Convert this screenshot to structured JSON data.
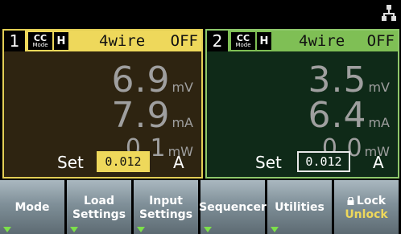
{
  "channels": [
    {
      "number": "1",
      "mode": "CC",
      "mode_label": "Mode",
      "range": "H",
      "sense": "4wire",
      "output": "OFF",
      "voltage": {
        "value": "6.9",
        "unit": "mV"
      },
      "current": {
        "value": "7.9",
        "unit": "mA"
      },
      "power": {
        "value": "0.1",
        "unit": "mW"
      },
      "set_label": "Set",
      "set_value": "0.012",
      "set_unit": "A"
    },
    {
      "number": "2",
      "mode": "CC",
      "mode_label": "Mode",
      "range": "H",
      "sense": "4wire",
      "output": "OFF",
      "voltage": {
        "value": "3.5",
        "unit": "mV"
      },
      "current": {
        "value": "6.4",
        "unit": "mA"
      },
      "power": {
        "value": "0.0",
        "unit": "mW"
      },
      "set_label": "Set",
      "set_value": "0.012",
      "set_unit": "A"
    }
  ],
  "softkeys": {
    "mode": "Mode",
    "load_settings_1": "Load",
    "load_settings_2": "Settings",
    "input_settings_1": "Input",
    "input_settings_2": "Settings",
    "sequencer": "Sequencer",
    "utilities": "Utilities",
    "lock": "Lock",
    "unlock": "Unlock"
  },
  "icons": {
    "network": "network-icon",
    "submenu": "submenu-arrow-icon",
    "lock": "lock-icon"
  },
  "colors": {
    "ch1_accent": "#eed85b",
    "ch2_accent": "#7fbf55",
    "submenu_arrow": "#7ce04a"
  }
}
